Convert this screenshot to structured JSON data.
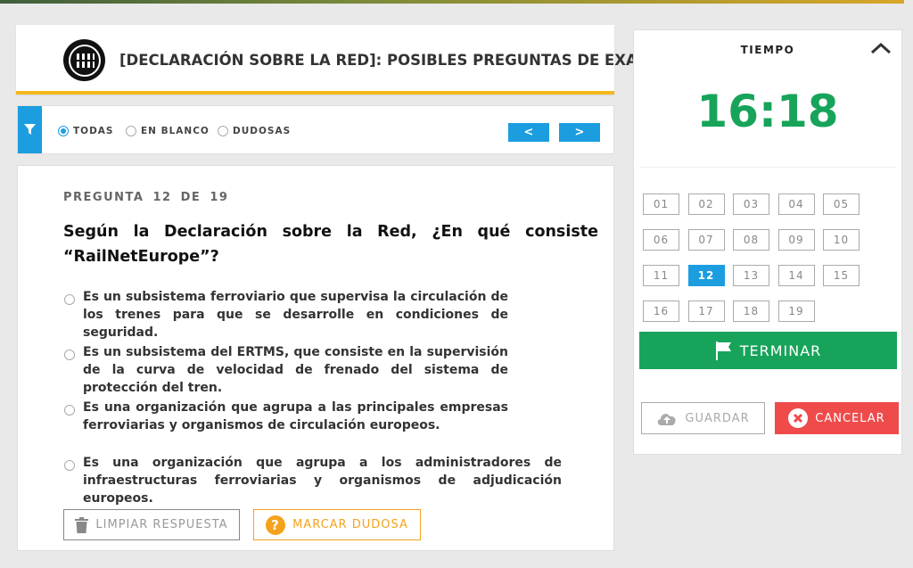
{
  "header": {
    "title": "[DECLARACIÓN SOBRE LA RED]: POSIBLES PREGUNTAS DE EXAMEN",
    "logo_icon": "circular-logo"
  },
  "filter": {
    "icon": "filter-icon",
    "options": [
      {
        "label": "TODAS",
        "selected": true
      },
      {
        "label": "EN BLANCO",
        "selected": false
      },
      {
        "label": "DUDOSAS",
        "selected": false
      }
    ],
    "prev_label": "<",
    "next_label": ">"
  },
  "question": {
    "counter_prefix": "PREGUNTA",
    "current": "12",
    "counter_of": "DE",
    "total": "19",
    "text": "Según la Declaración sobre la Red, ¿En qué consiste “RailNetEurope”?",
    "answers": [
      "Es un subsistema ferroviario que supervisa la circulación de los trenes para que se desarrolle en condiciones de seguridad.",
      "Es un subsistema del ERTMS, que consiste en la supervisión de la curva de velocidad de frenado del sistema de protección del tren.",
      "Es una organización que agrupa a las principales empresas ferroviarias y organismos de circulación europeos.",
      "Es una organización que agrupa a los administradores de infraestructuras ferroviarias y organismos de adjudicación europeos."
    ],
    "clear_label": "LIMPIAR RESPUESTA",
    "doubt_label": "MARCAR DUDOSA"
  },
  "timer": {
    "label": "TIEMPO",
    "value": "16:18"
  },
  "navigator": {
    "items": [
      "01",
      "02",
      "03",
      "04",
      "05",
      "06",
      "07",
      "08",
      "09",
      "10",
      "11",
      "12",
      "13",
      "14",
      "15",
      "16",
      "17",
      "18",
      "19"
    ],
    "active": "12"
  },
  "actions": {
    "finish_label": "TERMINAR",
    "save_label": "GUARDAR",
    "cancel_label": "CANCELAR"
  },
  "colors": {
    "accent_blue": "#1b9de0",
    "success_green": "#17a45a",
    "danger_red": "#ef4b4b",
    "warning_orange": "#f4a21c",
    "header_underline": "#f5b81c"
  }
}
